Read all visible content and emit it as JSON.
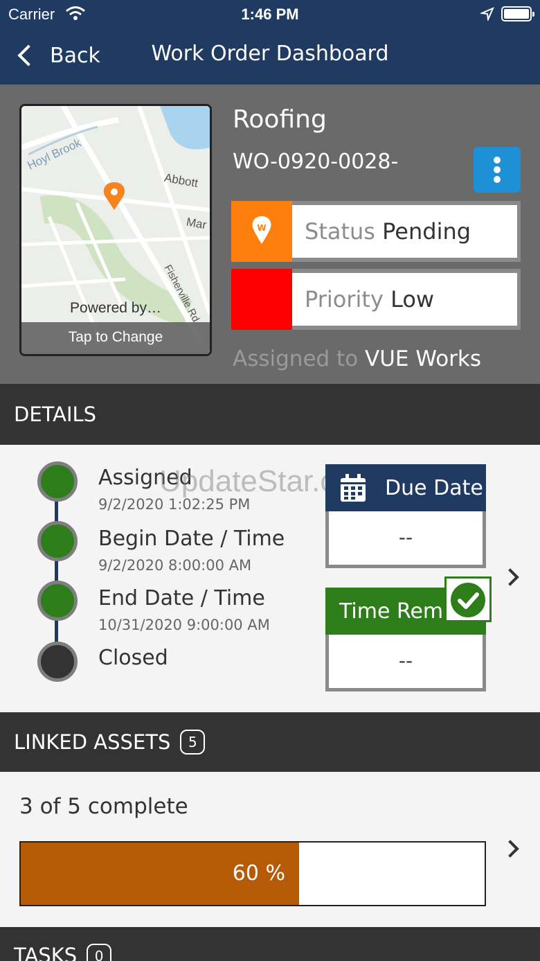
{
  "status_bar": {
    "carrier": "Carrier",
    "time": "1:46 PM"
  },
  "nav": {
    "back_label": "Back",
    "title": "Work Order Dashboard"
  },
  "map": {
    "labels": [
      "Hoyl Brook",
      "Abbott",
      "Mar",
      "Fisherville Rd"
    ],
    "powered_by": "Powered by…",
    "tap_label": "Tap to Change"
  },
  "work_order": {
    "title": "Roofing",
    "number": "WO-0920-0028-",
    "status_label": "Status",
    "status_value": "Pending",
    "status_color": "#ff7f0e",
    "priority_label": "Priority",
    "priority_value": "Low",
    "priority_color": "#ff0000",
    "assigned_prefix": "Assigned to",
    "assigned_to": "VUE Works"
  },
  "details": {
    "header": "DETAILS",
    "watermark": "UpdateStar.com",
    "events": [
      {
        "label": "Assigned",
        "date": "9/2/2020 1:02:25 PM",
        "state": "done"
      },
      {
        "label": "Begin Date / Time",
        "date": "9/2/2020 8:00:00 AM",
        "state": "done"
      },
      {
        "label": "End Date / Time",
        "date": "10/31/2020 9:00:00 AM",
        "state": "done"
      },
      {
        "label": "Closed",
        "date": "",
        "state": "closed"
      }
    ],
    "due_date": {
      "label": "Due Date",
      "value": "--"
    },
    "time_remaining": {
      "label": "Time Rem",
      "value": "--"
    }
  },
  "linked_assets": {
    "header": "LINKED ASSETS",
    "count": "5",
    "complete_text": "3 of 5 complete",
    "progress_percent": 60,
    "progress_label": "60 %",
    "bar_color": "#b55a05"
  },
  "tasks": {
    "header": "TASKS",
    "count": "0"
  }
}
